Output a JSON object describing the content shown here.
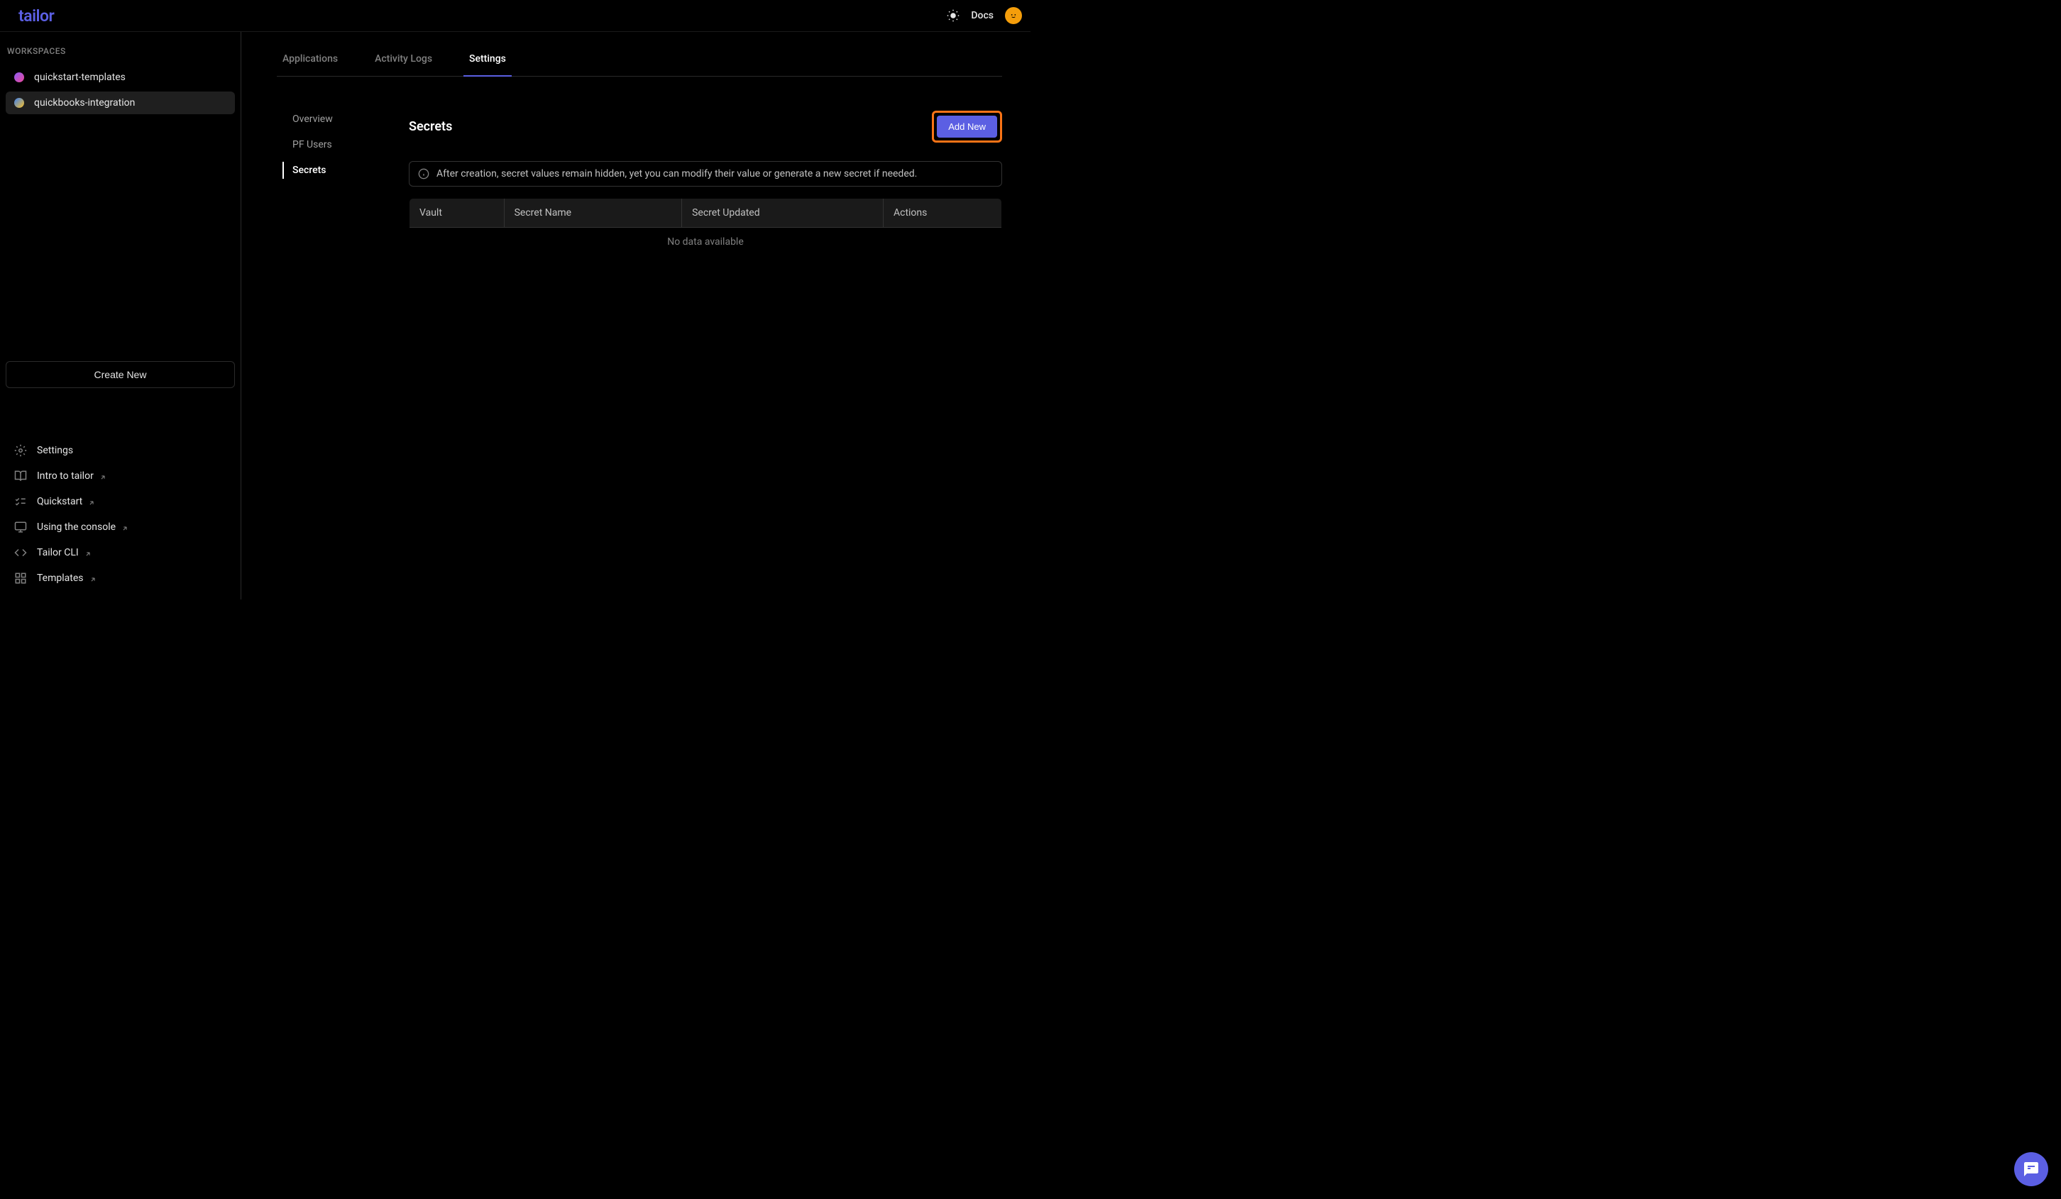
{
  "header": {
    "logo": "tailor",
    "docs": "Docs"
  },
  "sidebar": {
    "workspaces_label": "WORKSPACES",
    "workspaces": [
      {
        "name": "quickstart-templates"
      },
      {
        "name": "quickbooks-integration"
      }
    ],
    "create_new": "Create New",
    "links": [
      {
        "label": "Settings",
        "external": false
      },
      {
        "label": "Intro to tailor",
        "external": true
      },
      {
        "label": "Quickstart",
        "external": true
      },
      {
        "label": "Using the console",
        "external": true
      },
      {
        "label": "Tailor CLI",
        "external": true
      },
      {
        "label": "Templates",
        "external": true
      }
    ]
  },
  "tabs": [
    {
      "label": "Applications"
    },
    {
      "label": "Activity Logs"
    },
    {
      "label": "Settings"
    }
  ],
  "sub_nav": [
    {
      "label": "Overview"
    },
    {
      "label": "PF Users"
    },
    {
      "label": "Secrets"
    }
  ],
  "page": {
    "title": "Secrets",
    "add_new": "Add New",
    "info": "After creation, secret values remain hidden, yet you can modify their value or generate a new secret if needed.",
    "columns": {
      "vault": "Vault",
      "secret_name": "Secret Name",
      "secret_updated": "Secret Updated",
      "actions": "Actions"
    },
    "no_data": "No data available"
  }
}
